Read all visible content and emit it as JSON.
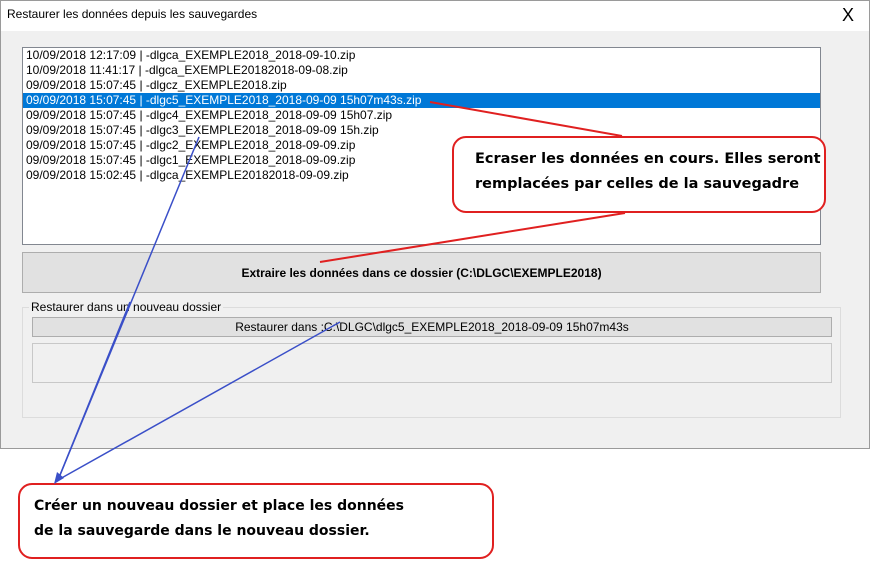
{
  "window": {
    "title": "Restaurer les données depuis les sauvegardes",
    "close_label": "X"
  },
  "backups": {
    "selected_index": 3,
    "items": [
      "10/09/2018 12:17:09 | -dlgca_EXEMPLE2018_2018-09-10.zip",
      "10/09/2018 11:41:17 | -dlgca_EXEMPLE20182018-09-08.zip",
      "09/09/2018 15:07:45 | -dlgcz_EXEMPLE2018.zip",
      "09/09/2018 15:07:45 | -dlgc5_EXEMPLE2018_2018-09-09 15h07m43s.zip",
      "09/09/2018 15:07:45 | -dlgc4_EXEMPLE2018_2018-09-09 15h07.zip",
      "09/09/2018 15:07:45 | -dlgc3_EXEMPLE2018_2018-09-09 15h.zip",
      "09/09/2018 15:07:45 | -dlgc2_EXEMPLE2018_2018-09-09.zip",
      "09/09/2018 15:07:45 | -dlgc1_EXEMPLE2018_2018-09-09.zip",
      "09/09/2018 15:02:45 | -dlgca_EXEMPLE20182018-09-09.zip"
    ]
  },
  "extract_button": {
    "label": "Extraire les données dans ce dossier (C:\\DLGC\\EXEMPLE2018)"
  },
  "new_folder_group": {
    "label": "Restaurer dans un nouveau dossier",
    "restore_button_label": "Restaurer dans :C:\\DLGC\\dlgc5_EXEMPLE2018_2018-09-09 15h07m43s"
  },
  "annotations": {
    "overwrite": {
      "line1": "Ecraser les données en cours. Elles seront",
      "line2": "remplacées par celles de la sauvegadre"
    },
    "new_folder": {
      "line1": "Créer un nouveau dossier et place les données",
      "line2": "de la sauvegarde dans le nouveau dossier."
    },
    "colors": {
      "red_arrow": "#e02020",
      "blue_arrow": "#3a4fc8",
      "selection": "#0078d7"
    }
  }
}
